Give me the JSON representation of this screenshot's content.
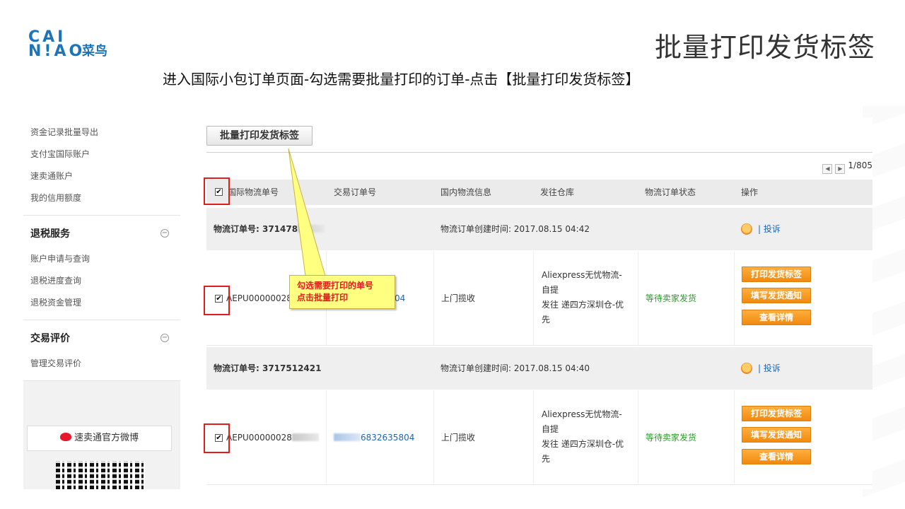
{
  "logo": {
    "line1": "CAI",
    "line2": "N!AO",
    "cn": "菜鸟"
  },
  "slide": {
    "title": "批量打印发货标签",
    "subtitle": "进入国际小包订单页面-勾选需要批量打印的订单-点击【批量打印发货标签】"
  },
  "sidebar": {
    "links_top": [
      "资金记录批量导出",
      "支付宝国际账户",
      "速卖通账户",
      "我的信用额度"
    ],
    "sections": [
      {
        "title": "退税服务",
        "toggle": "−",
        "items": [
          "账户申请与查询",
          "退税进度查询",
          "退税资金管理"
        ]
      },
      {
        "title": "交易评价",
        "toggle": "−",
        "items": [
          "管理交易评价"
        ]
      }
    ],
    "weibo_label": "速卖通官方微博"
  },
  "toolbar": {
    "batch_print_label": "批量打印发货标签"
  },
  "pager": {
    "prev": "◀",
    "next": "▶",
    "text": "1/805"
  },
  "table": {
    "headers": [
      "国际物流单号",
      "交易订单号",
      "国内物流信息",
      "发往仓库",
      "物流订单状态",
      "操作"
    ],
    "check_mark": "✔",
    "groups": [
      {
        "logistics_no": "物流订单号: 371478",
        "created": "物流订单创建时间: 2017.08.15 04:42",
        "ops_link": "| 投诉",
        "tracking": "AEPU00000028",
        "order_no": "04",
        "domestic": "上门揽收",
        "warehouse_lines": [
          "Aliexpress无忧物流-",
          "自提",
          "发往 递四方深圳仓-优",
          "先"
        ],
        "status": "等待卖家发货",
        "buttons": [
          "打印发货标签",
          "填写发货通知",
          "查看详情"
        ]
      },
      {
        "logistics_no": "物流订单号: 3717512421",
        "created": "物流订单创建时间: 2017.08.15 04:40",
        "ops_link": "| 投诉",
        "tracking": "AEPU00000028",
        "order_no": "6832635804",
        "domestic": "上门揽收",
        "warehouse_lines": [
          "Aliexpress无忧物流-",
          "自提",
          "发往 递四方深圳仓-优",
          "先"
        ],
        "status": "等待卖家发货",
        "buttons": [
          "打印发货标签",
          "填写发货通知",
          "查看详情"
        ]
      }
    ]
  },
  "callout": {
    "line1": "勾选需要打印的单号",
    "line2": "点击批量打印"
  },
  "colors": {
    "accent_orange": "#f08a10",
    "annotation_red": "#e01e1e",
    "link_blue": "#1a66b8",
    "status_green": "#2a9a2a",
    "callout_yellow": "#ffff80"
  }
}
